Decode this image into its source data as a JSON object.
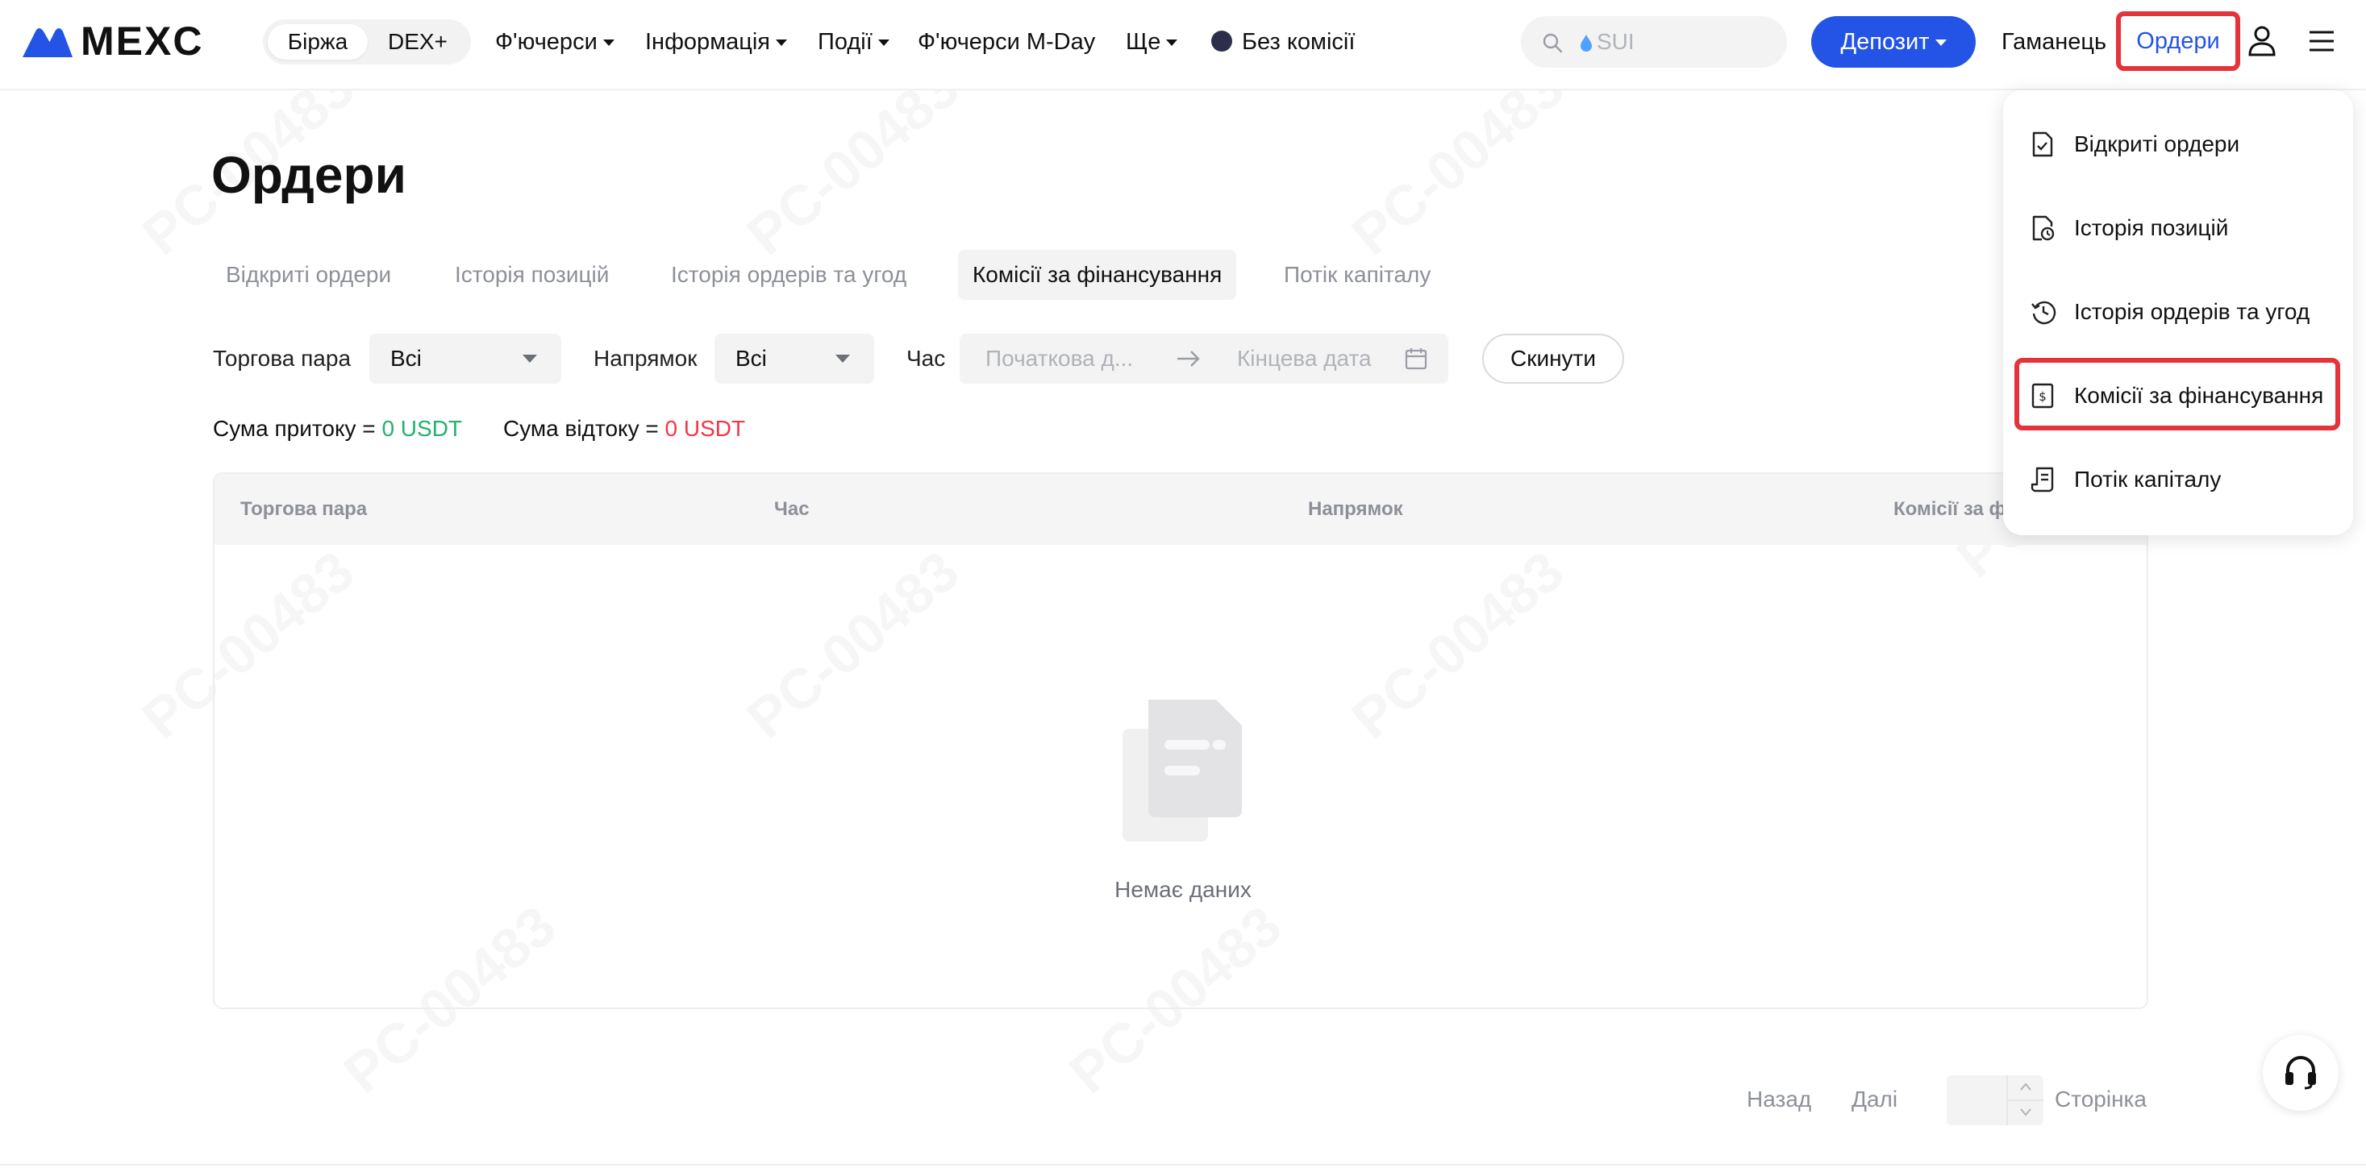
{
  "header": {
    "logo_text": "MEXC",
    "segment": {
      "items": [
        "Біржа",
        "DEX+"
      ],
      "active_index": 0
    },
    "nav": [
      {
        "label": "Ф'ючерси",
        "has_caret": true
      },
      {
        "label": "Інформація",
        "has_caret": true
      },
      {
        "label": "Події",
        "has_caret": true
      },
      {
        "label": "Ф'ючерси M-Day",
        "has_caret": false
      },
      {
        "label": "Ще",
        "has_caret": true
      },
      {
        "label": "Без комісії",
        "has_caret": false
      }
    ],
    "search_placeholder": "SUI",
    "deposit_label": "Депозит",
    "wallet_label": "Гаманець",
    "orders_label": "Ордери"
  },
  "page": {
    "title": "Ордери",
    "tabs": [
      "Відкриті ордери",
      "Історія позицій",
      "Історія ордерів та угод",
      "Комісії за фінансування",
      "Потік капіталу"
    ],
    "active_tab_index": 3,
    "filters": {
      "pair_label": "Торгова пара",
      "pair_value": "Всі",
      "direction_label": "Напрямок",
      "direction_value": "Всі",
      "time_label": "Час",
      "start_placeholder": "Початкова д...",
      "end_placeholder": "Кінцева дата",
      "reset_label": "Скинути"
    },
    "summary": {
      "inflow_label": "Сума притоку =",
      "inflow_value": "0 USDT",
      "outflow_label": "Сума відтоку =",
      "outflow_value": "0 USDT"
    },
    "table": {
      "columns": [
        "Торгова пара",
        "Час",
        "Напрямок",
        "Комісії за ф"
      ],
      "empty_text": "Немає даних"
    },
    "pagination": {
      "prev_label": "Назад",
      "next_label": "Далі",
      "page_label": "Сторінка"
    }
  },
  "dropdown": {
    "items": [
      {
        "label": "Відкриті ордери",
        "icon": "file-check-icon"
      },
      {
        "label": "Історія позицій",
        "icon": "file-clock-icon"
      },
      {
        "label": "Історія ордерів та угод",
        "icon": "history-icon"
      },
      {
        "label": "Комісії за фінансування",
        "icon": "dollar-doc-icon"
      },
      {
        "label": "Потік капіталу",
        "icon": "ledger-icon"
      }
    ],
    "highlight_index": 3
  },
  "colors": {
    "accent": "#2354e6",
    "highlight_border": "#e5333b",
    "positive": "#20b26c",
    "negative": "#f23645"
  }
}
